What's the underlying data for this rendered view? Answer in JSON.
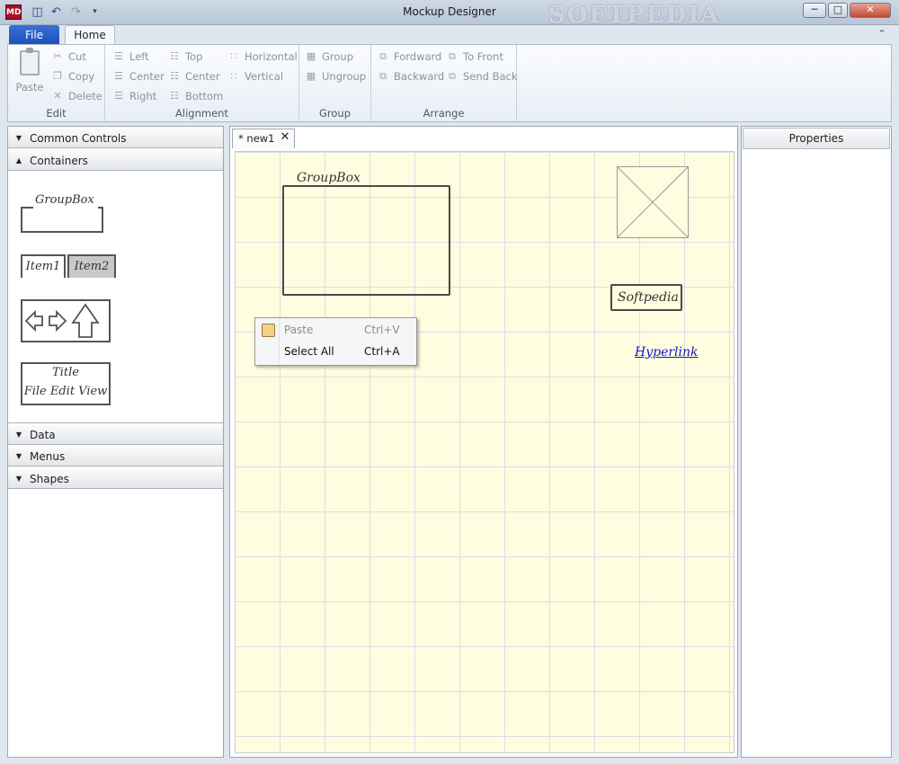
{
  "window": {
    "app_icon_text": "MD",
    "title": "Mockup Designer",
    "watermark": "SOFTPEDIA",
    "minimize": "─",
    "maximize": "□",
    "close": "✕"
  },
  "quick_access": {
    "save_icon": "save-icon",
    "undo_icon": "undo-icon",
    "redo_icon": "redo-icon",
    "customize_icon": "dropdown-icon"
  },
  "ribbon": {
    "tabs": {
      "file": "File",
      "home": "Home"
    },
    "edit": {
      "label": "Edit",
      "paste": "Paste",
      "cut": "Cut",
      "copy": "Copy",
      "delete": "Delete"
    },
    "alignment": {
      "label": "Alignment",
      "left": "Left",
      "center": "Center",
      "right": "Right",
      "top": "Top",
      "center_v": "Center",
      "bottom": "Bottom",
      "horizontal": "Horizontal",
      "vertical": "Vertical"
    },
    "group": {
      "label": "Group",
      "group": "Group",
      "ungroup": "Ungroup"
    },
    "arrange": {
      "label": "Arrange",
      "forward": "Fordward",
      "backward": "Backward",
      "to_front": "To Front",
      "send_back": "Send Back"
    }
  },
  "toolbox": {
    "sections": {
      "common_controls": "Common Controls",
      "containers": "Containers",
      "data": "Data",
      "menus": "Menus",
      "shapes": "Shapes"
    },
    "containers": {
      "groupbox": "GroupBox",
      "tab1": "Item1",
      "tab2": "Item2",
      "window_title": "Title",
      "window_menu": "File Edit View"
    }
  },
  "document": {
    "tab_label": "* new1",
    "tab_close": "✕",
    "canvas": {
      "groupbox_label": "GroupBox",
      "button_label": "Softpedia",
      "hyperlink": "Hyperlink"
    }
  },
  "context_menu": {
    "items": [
      {
        "label": "Paste",
        "shortcut": "Ctrl+V",
        "enabled": false
      },
      {
        "label": "Select All",
        "shortcut": "Ctrl+A",
        "enabled": true
      }
    ]
  },
  "properties": {
    "title": "Properties"
  }
}
